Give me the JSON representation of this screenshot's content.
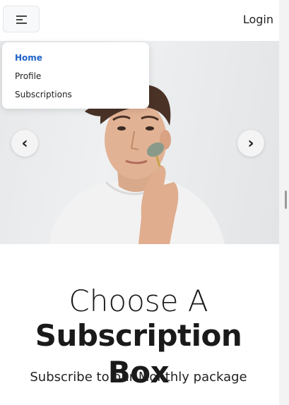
{
  "header": {
    "login_label": "Login"
  },
  "dropdown": {
    "items": [
      {
        "label": "Home",
        "active": true
      },
      {
        "label": "Profile",
        "active": false
      },
      {
        "label": "Subscriptions",
        "active": false
      }
    ]
  },
  "carousel": {
    "prev_glyph": "‹",
    "next_glyph": "›"
  },
  "hero_text": {
    "line1": "Choose A",
    "line2": "Subscription Box",
    "subtitle": "Subscribe to our Monthly package"
  },
  "icons": {
    "menu": "hamburger-menu-icon"
  },
  "colors": {
    "accent": "#1e63c8",
    "background": "#ffffff"
  }
}
